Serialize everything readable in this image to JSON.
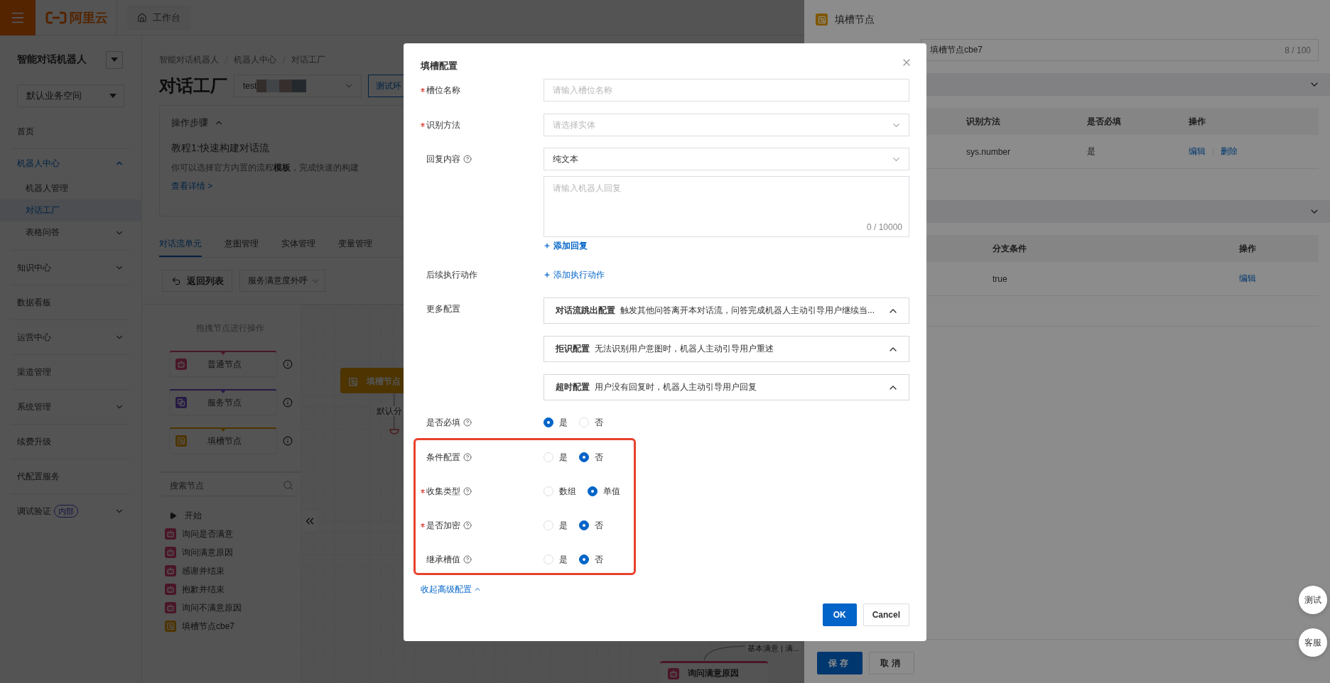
{
  "header": {
    "logo_text": "阿里云",
    "workbench_tab": "工作台"
  },
  "sidebar": {
    "product": "智能对话机器人",
    "workspace": "默认业务空间",
    "items": [
      {
        "label": "首页",
        "kind": "link",
        "selected": false
      },
      {
        "label": "机器人中心",
        "kind": "group",
        "expanded": true,
        "selected": true,
        "children": [
          {
            "label": "机器人管理",
            "kind": "link",
            "selected": false
          },
          {
            "label": "对话工厂",
            "kind": "link",
            "selected": true
          },
          {
            "label": "表格问答",
            "kind": "group",
            "expanded": false,
            "selected": false
          }
        ]
      },
      {
        "label": "知识中心",
        "kind": "group",
        "expanded": false,
        "selected": false
      },
      {
        "label": "数据看板",
        "kind": "link",
        "selected": false
      },
      {
        "label": "运营中心",
        "kind": "group",
        "expanded": false,
        "selected": false
      },
      {
        "label": "渠道管理",
        "kind": "link",
        "selected": false
      },
      {
        "label": "系统管理",
        "kind": "group",
        "expanded": false,
        "selected": false
      },
      {
        "label": "续费升级",
        "kind": "link",
        "selected": false
      },
      {
        "label": "代配置服务",
        "kind": "link",
        "selected": false
      },
      {
        "label": "调试验证",
        "kind": "group",
        "expanded": false,
        "selected": false,
        "badge": "内部"
      }
    ]
  },
  "main": {
    "breadcrumb": [
      "智能对话机器人",
      "机器人中心",
      "对话工厂"
    ],
    "title": "对话工厂",
    "env_select": "test",
    "env_button": "测试环",
    "steps_card": {
      "title": "操作步骤",
      "expanded": true,
      "tutorial": "教程1:快速构建对话流",
      "description": "你可以选择官方内置的流程**模板**，完成快速的构建",
      "link": "查看详情 >"
    },
    "tabs": [
      {
        "label": "对话流单元",
        "selected": true
      },
      {
        "label": "意图管理",
        "selected": false
      },
      {
        "label": "实体管理",
        "selected": false
      },
      {
        "label": "变量管理",
        "selected": false
      }
    ],
    "toolbar": {
      "back_button": "返回列表",
      "flow_select": "服务满意度外呼"
    }
  },
  "canvas": {
    "palette": {
      "hint": "拖拽节点进行操作",
      "node_types": [
        {
          "label": "普通节点",
          "kind": "normal"
        },
        {
          "label": "服务节点",
          "kind": "service"
        },
        {
          "label": "填槽节点",
          "kind": "slot"
        }
      ]
    },
    "search": {
      "placeholder": "搜索节点"
    },
    "tree": [
      {
        "label": "开始",
        "kind": "start"
      },
      {
        "label": "询问是否满意",
        "kind": "normal"
      },
      {
        "label": "询问满意原因",
        "kind": "normal"
      },
      {
        "label": "感谢并结束",
        "kind": "normal"
      },
      {
        "label": "抱歉并结束",
        "kind": "normal"
      },
      {
        "label": "询问不满意原因",
        "kind": "normal"
      },
      {
        "label": "填槽节点cbe7",
        "kind": "slot"
      }
    ],
    "nodes": [
      {
        "label": "填槽节点",
        "kind": "slot"
      },
      {
        "label": "询问满意原因",
        "kind": "normal"
      }
    ],
    "links": [
      {
        "label": "默认分"
      },
      {
        "label": "基本满意 | 满..."
      }
    ]
  },
  "drawer": {
    "title": "填槽节点",
    "name_value": "填槽节点cbe7",
    "name_counter": "8 / 100",
    "slot_table": {
      "columns": [
        "识别方法",
        "是否必填",
        "操作"
      ],
      "rows": [
        {
          "cells": [
            "sys.number",
            "是"
          ],
          "actions": [
            "编辑",
            "删除"
          ]
        }
      ]
    },
    "branch_table": {
      "columns": [
        "分支条件",
        "操作"
      ],
      "rows": [
        {
          "cells": [
            "true"
          ],
          "actions": [
            "编辑"
          ]
        }
      ]
    },
    "buttons": [
      {
        "label": "保存",
        "kind": "primary"
      },
      {
        "label": "取消",
        "kind": "default"
      }
    ]
  },
  "float_buttons": [
    "测试",
    "客服"
  ],
  "modal": {
    "title": "填槽配置",
    "fields": [
      {
        "kind": "input",
        "label": "槽位名称",
        "required": true,
        "help": false,
        "placeholder": "请输入槽位名称"
      },
      {
        "kind": "select",
        "label": "识别方法",
        "required": true,
        "help": false,
        "placeholder": "请选择实体"
      },
      {
        "kind": "reply",
        "label": "回复内容",
        "required": false,
        "help": true,
        "value": "纯文本",
        "reply_placeholder": "请输入机器人回复",
        "counter": "0 / 10000",
        "add_link": "添加回复"
      },
      {
        "kind": "action",
        "label": "后续执行动作",
        "required": false,
        "help": false,
        "link": "添加执行动作"
      },
      {
        "kind": "panels",
        "label": "更多配置",
        "required": false,
        "help": false,
        "panels": [
          {
            "title": "对话流跳出配置",
            "description": "触发其他问答离开本对话流，问答完成机器人主动引导用户继续当..."
          },
          {
            "title": "拒识配置",
            "description": "无法识别用户意图时，机器人主动引导用户重述"
          },
          {
            "title": "超时配置",
            "description": "用户没有回复时，机器人主动引导用户回复"
          }
        ]
      },
      {
        "kind": "radio",
        "label": "是否必填",
        "required": false,
        "help": true,
        "options": [
          {
            "label": "是",
            "selected": true
          },
          {
            "label": "否",
            "selected": false
          }
        ]
      }
    ],
    "advanced_highlighted": true,
    "advanced_fields": [
      {
        "kind": "radio",
        "label": "条件配置",
        "required": false,
        "help": true,
        "options": [
          {
            "label": "是",
            "selected": false
          },
          {
            "label": "否",
            "selected": true
          }
        ]
      },
      {
        "kind": "radio",
        "label": "收集类型",
        "required": true,
        "help": true,
        "options": [
          {
            "label": "数组",
            "selected": false
          },
          {
            "label": "单值",
            "selected": true
          }
        ]
      },
      {
        "kind": "radio",
        "label": "是否加密",
        "required": true,
        "help": true,
        "options": [
          {
            "label": "是",
            "selected": false
          },
          {
            "label": "否",
            "selected": true
          }
        ]
      },
      {
        "kind": "radio",
        "label": "继承槽值",
        "required": false,
        "help": true,
        "options": [
          {
            "label": "是",
            "selected": false
          },
          {
            "label": "否",
            "selected": true
          }
        ]
      }
    ],
    "collapse_link": "收起高级配置",
    "buttons": [
      {
        "label": "OK",
        "kind": "primary"
      },
      {
        "label": "Cancel",
        "kind": "default"
      }
    ]
  }
}
